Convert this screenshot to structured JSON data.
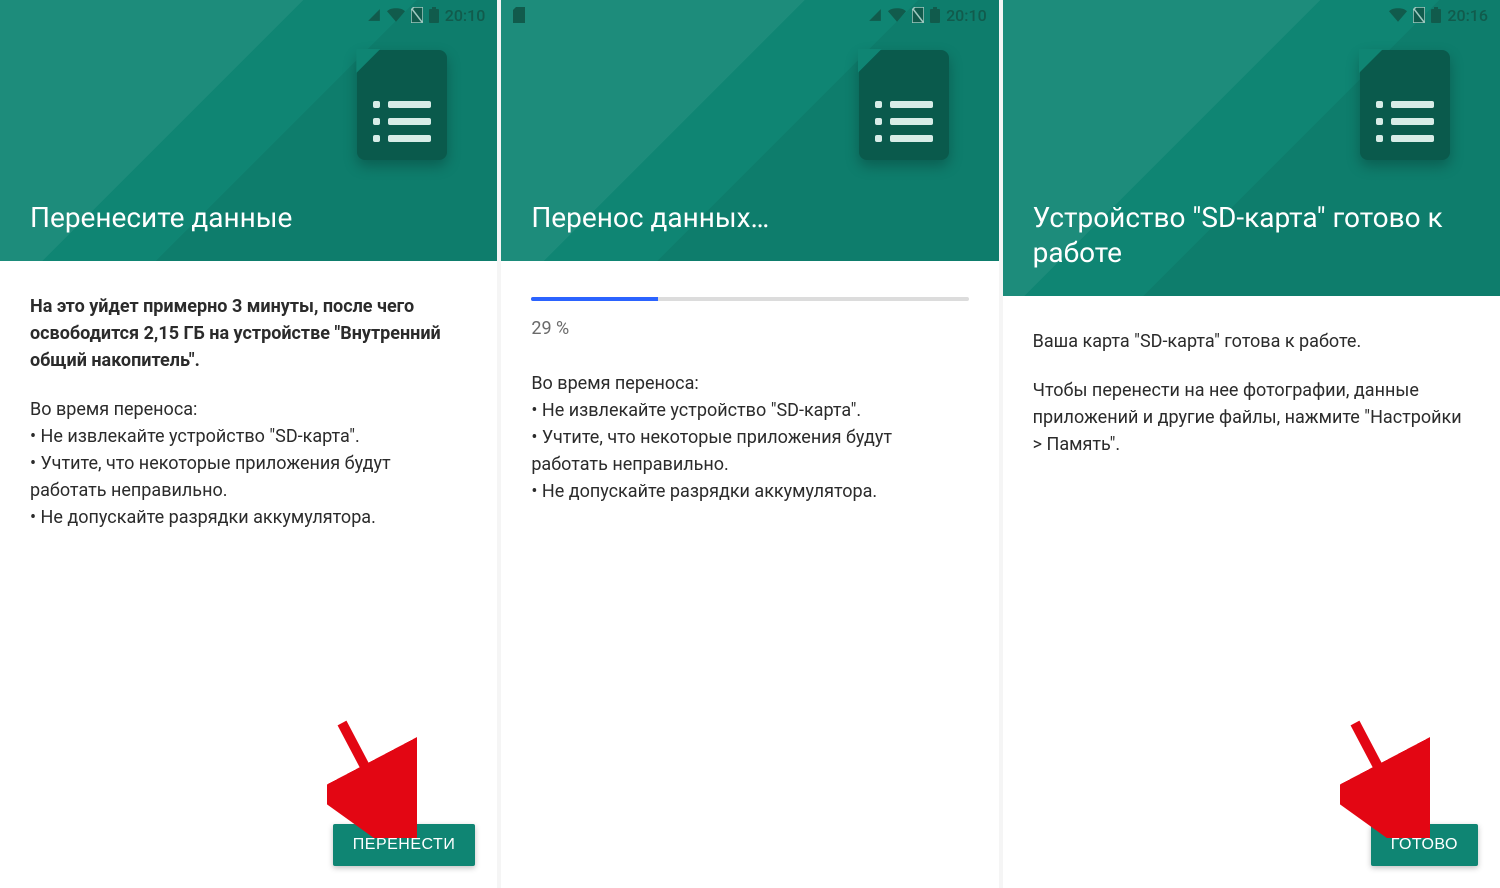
{
  "screens": [
    {
      "statusbar": {
        "time": "20:10",
        "sd_left": false
      },
      "title": "Перенесите данные",
      "body": {
        "lead_bold": "На это уйдет примерно 3 минуты, после чего освободится 2,15 ГБ на устройстве \"Внутренний общий накопитель\".",
        "subhead": "Во время переноса:",
        "bullets": [
          "• Не извлекайте устройство \"SD-карта\".",
          "• Учтите, что некоторые приложения будут работать неправильно.",
          "• Не допускайте разрядки аккумулятора."
        ]
      },
      "button": "ПЕРЕНЕСТИ",
      "arrow": true
    },
    {
      "statusbar": {
        "time": "20:10",
        "sd_left": true
      },
      "title": "Перенос данных…",
      "progress": {
        "percent": 29,
        "label": "29 %"
      },
      "body": {
        "subhead": "Во время переноса:",
        "bullets": [
          "• Не извлекайте устройство \"SD-карта\".",
          "• Учтите, что некоторые приложения будут работать неправильно.",
          "• Не допускайте разрядки аккумулятора."
        ]
      }
    },
    {
      "statusbar": {
        "time": "20:16",
        "sd_left": false
      },
      "title": "Устройство \"SD-карта\" готово к работе",
      "body": {
        "paragraphs": [
          "Ваша карта \"SD-карта\" готова к работе.",
          "Чтобы перенести на нее фотографии, данные приложений и другие файлы, нажмите \"Настройки > Память\"."
        ]
      },
      "button": "ГОТОВО",
      "arrow": true
    }
  ]
}
